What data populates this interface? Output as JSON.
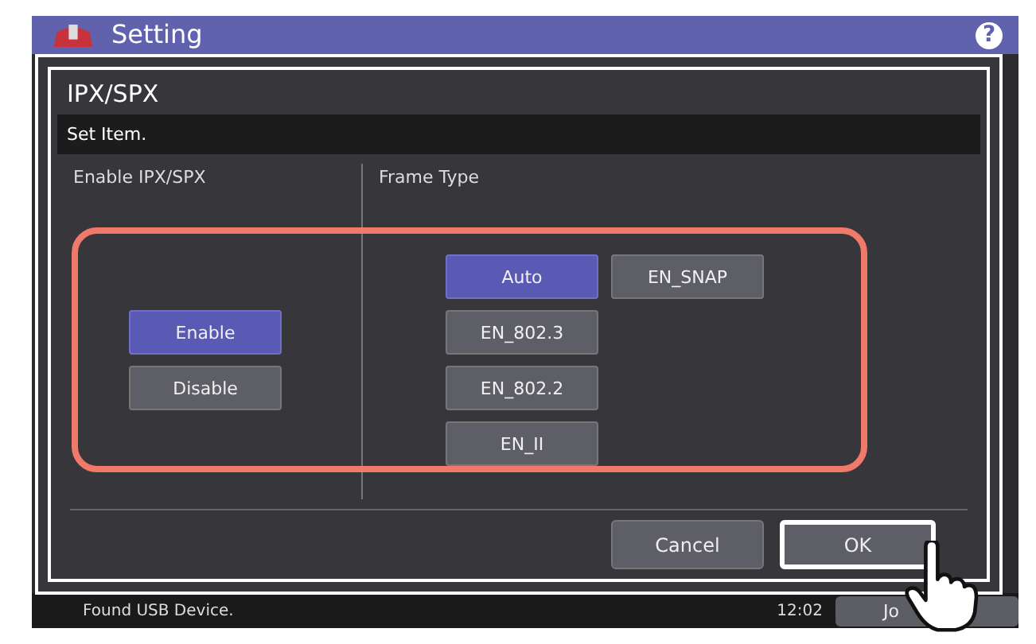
{
  "screen": {
    "title": "Setting",
    "help": "?"
  },
  "dialog": {
    "title": "IPX/SPX",
    "instruction": "Set Item.",
    "sections": [
      {
        "heading": "Enable IPX/SPX",
        "options": [
          [
            {
              "label": "Enable",
              "selected": true
            }
          ],
          [
            {
              "label": "Disable",
              "selected": false
            }
          ]
        ]
      },
      {
        "heading": "Frame Type",
        "options": [
          [
            {
              "label": "Auto",
              "selected": true
            },
            {
              "label": "EN_SNAP",
              "selected": false
            }
          ],
          [
            {
              "label": "EN_802.3",
              "selected": false
            }
          ],
          [
            {
              "label": "EN_802.2",
              "selected": false
            }
          ],
          [
            {
              "label": "EN_II",
              "selected": false
            }
          ]
        ]
      }
    ],
    "buttons": [
      {
        "label": "Cancel",
        "focused": false
      },
      {
        "label": "OK",
        "focused": true
      }
    ]
  },
  "status_bar": {
    "message": "Found USB Device.",
    "time": "12:02",
    "job_button": "Jo"
  }
}
